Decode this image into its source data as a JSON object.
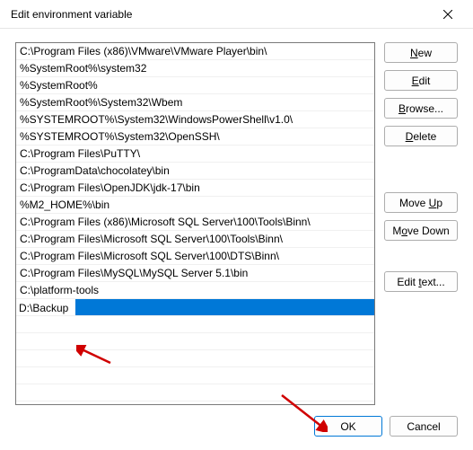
{
  "window": {
    "title": "Edit environment variable"
  },
  "list": {
    "items": [
      "C:\\Program Files (x86)\\VMware\\VMware Player\\bin\\",
      "%SystemRoot%\\system32",
      "%SystemRoot%",
      "%SystemRoot%\\System32\\Wbem",
      "%SYSTEMROOT%\\System32\\WindowsPowerShell\\v1.0\\",
      "%SYSTEMROOT%\\System32\\OpenSSH\\",
      "C:\\Program Files\\PuTTY\\",
      "C:\\ProgramData\\chocolatey\\bin",
      "C:\\Program Files\\OpenJDK\\jdk-17\\bin",
      "%M2_HOME%\\bin",
      "C:\\Program Files (x86)\\Microsoft SQL Server\\100\\Tools\\Binn\\",
      "C:\\Program Files\\Microsoft SQL Server\\100\\Tools\\Binn\\",
      "C:\\Program Files\\Microsoft SQL Server\\100\\DTS\\Binn\\",
      "C:\\Program Files\\MySQL\\MySQL Server 5.1\\bin",
      "C:\\platform-tools"
    ],
    "editing_value": "D:\\Backup"
  },
  "buttons": {
    "new": "New",
    "edit": "Edit",
    "browse": "Browse...",
    "delete": "Delete",
    "move_up": "Move Up",
    "move_down": "Move Down",
    "edit_text": "Edit text...",
    "ok": "OK",
    "cancel": "Cancel"
  }
}
